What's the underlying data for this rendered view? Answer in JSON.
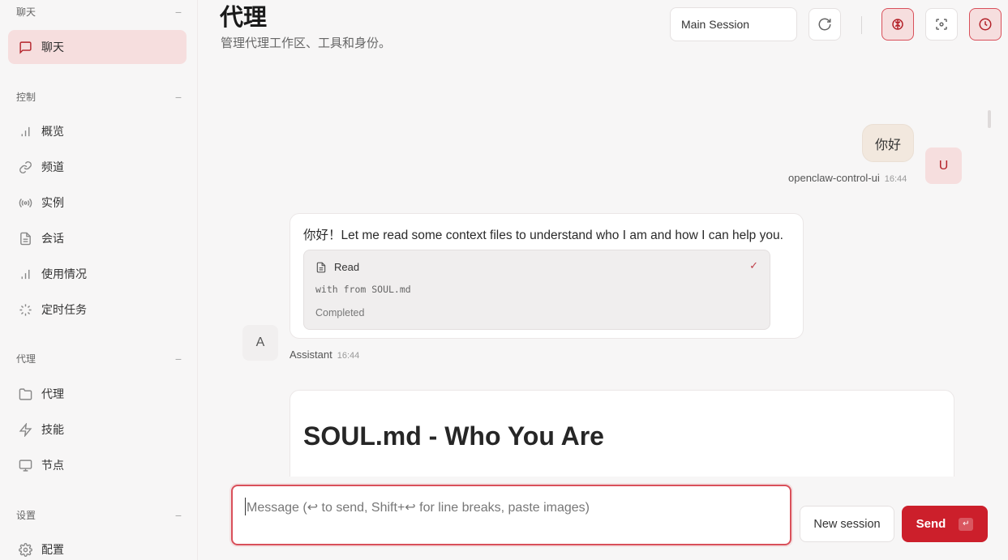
{
  "sidebar": {
    "sections": [
      {
        "title": "聊天",
        "collapse": "−"
      },
      {
        "title": "控制",
        "collapse": "−"
      },
      {
        "title": "代理",
        "collapse": "−"
      },
      {
        "title": "设置",
        "collapse": "−"
      }
    ],
    "items": {
      "chat": {
        "label": "聊天",
        "icon": "chat-bubble-icon"
      },
      "overview": {
        "label": "概览",
        "icon": "bar-chart-icon"
      },
      "channels": {
        "label": "频道",
        "icon": "link-icon"
      },
      "instances": {
        "label": "实例",
        "icon": "broadcast-icon"
      },
      "sessions": {
        "label": "会话",
        "icon": "document-icon"
      },
      "usage": {
        "label": "使用情况",
        "icon": "bar-chart-icon"
      },
      "cron": {
        "label": "定时任务",
        "icon": "loader-icon"
      },
      "agents": {
        "label": "代理",
        "icon": "folder-icon"
      },
      "skills": {
        "label": "技能",
        "icon": "lightning-icon"
      },
      "nodes": {
        "label": "节点",
        "icon": "monitor-icon"
      },
      "config": {
        "label": "配置",
        "icon": "gear-icon"
      }
    },
    "active_item": "chat"
  },
  "header": {
    "title": "代理",
    "subtitle": "管理代理工作区、工具和身份。",
    "session_select": "Main Session"
  },
  "messages": {
    "user": {
      "text": "你好",
      "avatar": "U",
      "sender": "openclaw-control-ui",
      "time": "16:44"
    },
    "assistant": {
      "text": "你好！Let me read some context files to understand who I am and how I can help you.",
      "avatar": "A",
      "sender": "Assistant",
      "time": "16:44",
      "tool": {
        "name": "Read",
        "check": "✓",
        "detail": "with from SOUL.md",
        "status": "Completed"
      }
    },
    "document": {
      "heading": "SOUL.md - Who You Are"
    }
  },
  "composer": {
    "placeholder": "Message (↩ to send, Shift+↩ for line breaks, paste images)",
    "new_session_label": "New session",
    "send_label": "Send",
    "send_key": "↵"
  },
  "colors": {
    "accent": "#cc1f2b",
    "accent_soft": "#f6dede",
    "background": "#f7f6f6"
  }
}
